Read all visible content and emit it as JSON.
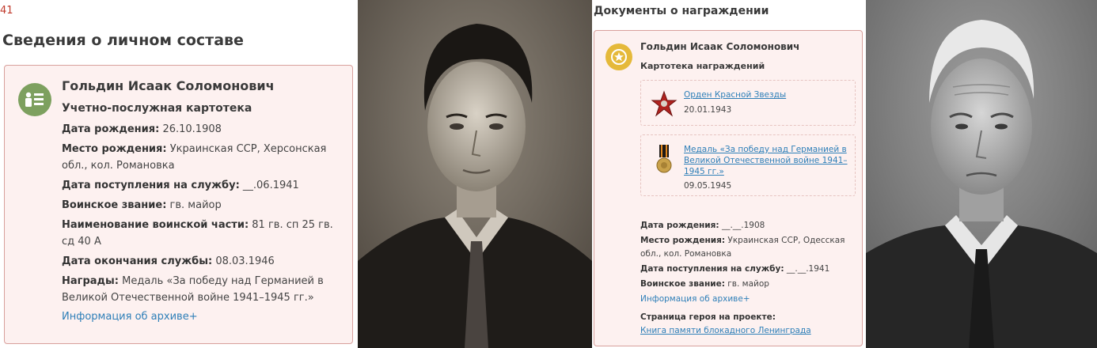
{
  "panel1": {
    "number": "41",
    "title": "Сведения о личном составе",
    "name": "Гольдин Исаак Соломонович",
    "card_type": "Учетно-послужная картотека",
    "fields": [
      {
        "label": "Дата рождения:",
        "value": " 26.10.1908"
      },
      {
        "label": "Место рождения:",
        "value": " Украинская ССР, Херсонская обл., кол. Романовка"
      },
      {
        "label": "Дата поступления на службу:",
        "value": " __.06.1941"
      },
      {
        "label": "Воинское звание:",
        "value": " гв. майор"
      },
      {
        "label": "Наименование воинской части:",
        "value": " 81 гв. сп 25 гв. сд 40 А"
      },
      {
        "label": "Дата окончания службы:",
        "value": " 08.03.1946"
      },
      {
        "label": "Награды:",
        "value": " Медаль «За победу над Германией в Великой Отечественной войне 1941–1945 гг.»"
      }
    ],
    "archive_link": "Информация об архиве+",
    "icon": "person-card-icon"
  },
  "panel2": {
    "title": "Документы о награждении",
    "name": "Гольдин Исаак Соломонович",
    "card_type": "Картотека награждений",
    "icon": "medal-icon",
    "awards": [
      {
        "name": "Орден Красной Звезды",
        "date": "20.01.1943",
        "icon": "red-star-order-icon"
      },
      {
        "name": "Медаль «За победу над Германией в Великой Отечественной войне 1941–1945 гг.»",
        "date": "09.05.1945",
        "icon": "victory-medal-icon"
      }
    ],
    "fields": [
      {
        "label": "Дата рождения:",
        "value": " __.__.1908"
      },
      {
        "label": "Место рождения:",
        "value": " Украинская ССР, Одесская обл., кол. Романовка"
      },
      {
        "label": "Дата поступления на службу:",
        "value": " __.__.1941"
      },
      {
        "label": "Воинское звание:",
        "value": " гв. майор"
      }
    ],
    "archive_link": "Информация об архиве+",
    "hero_label": "Страница героя на проекте:",
    "hero_link": "Книга памяти блокадного Ленинграда"
  },
  "colors": {
    "card_bg": "#fdf1f0",
    "card_border": "#d8a09c",
    "link": "#2e7fb8",
    "avatar_green": "#7da05f",
    "medal_gold": "#e5b93a",
    "number_red": "#c0392b"
  }
}
